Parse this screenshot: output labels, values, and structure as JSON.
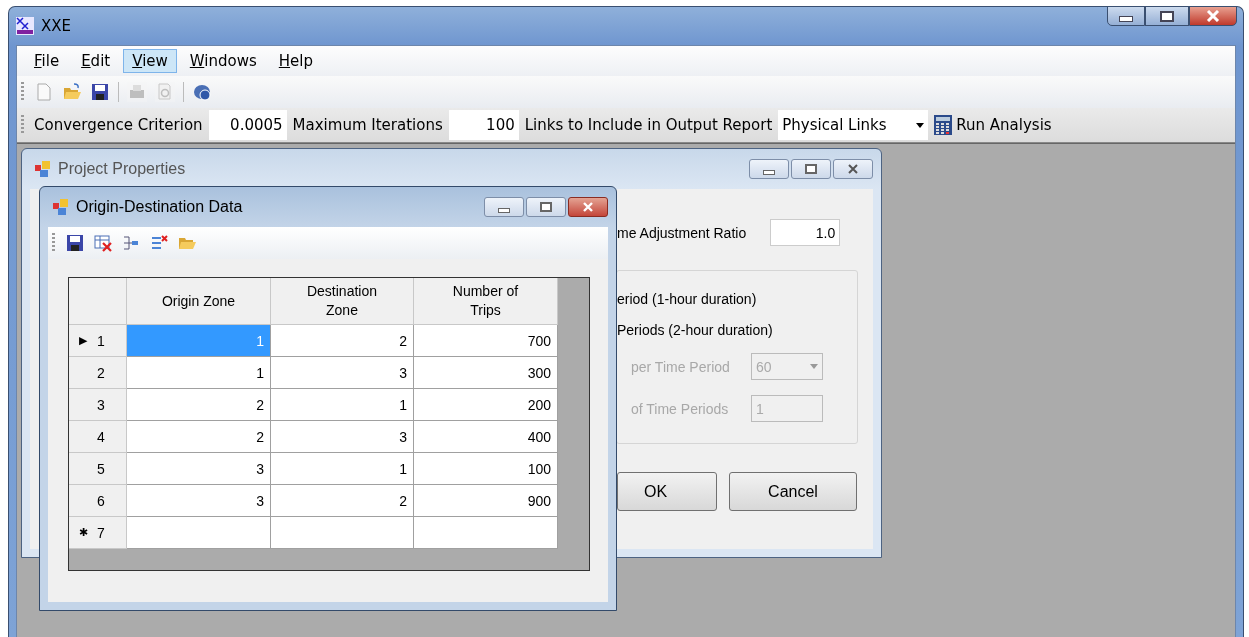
{
  "window": {
    "title": "XXE"
  },
  "menu": [
    {
      "label": "File",
      "selected": false
    },
    {
      "label": "Edit",
      "selected": false
    },
    {
      "label": "View",
      "selected": true
    },
    {
      "label": "Windows",
      "selected": false
    },
    {
      "label": "Help",
      "selected": false
    }
  ],
  "toolbar": [
    {
      "kind": "new",
      "disabled": false
    },
    {
      "kind": "open",
      "disabled": false
    },
    {
      "kind": "save",
      "disabled": false
    },
    {
      "kind": "separator"
    },
    {
      "kind": "print",
      "disabled": true
    },
    {
      "kind": "preview",
      "disabled": true
    },
    {
      "kind": "separator"
    },
    {
      "kind": "help",
      "disabled": false
    }
  ],
  "params": {
    "convergence_label": "Convergence Criterion",
    "convergence_value": "0.0005",
    "iterations_label": "Maximum Iterations",
    "iterations_value": "100",
    "links_label": "Links to Include in Output Report",
    "links_value": "Physical Links",
    "run_label": "Run Analysis"
  },
  "project_properties": {
    "title": "Project Properties",
    "ratio_label": "me Adjustment Ratio",
    "ratio_value": "1.0",
    "options": [
      "eriod (1-hour duration)",
      "Periods (2-hour duration)"
    ],
    "per_period_label": "per Time Period",
    "per_period_value": "60",
    "periods_label": "of Time Periods",
    "periods_value": "1",
    "disabled": true,
    "ok": "OK",
    "cancel": "Cancel"
  },
  "od_data": {
    "title": "Origin-Destination Data",
    "toolbar": [
      {
        "kind": "save"
      },
      {
        "kind": "delete"
      },
      {
        "kind": "insert"
      },
      {
        "kind": "remove"
      },
      {
        "kind": "open"
      }
    ],
    "columns": [
      {
        "label": "Origin Zone"
      },
      {
        "label": "Destination\nZone"
      },
      {
        "label": "Number of\nTrips"
      }
    ],
    "rows": [
      {
        "indicator": "▶",
        "number": "1",
        "cells": [
          {
            "text": "1",
            "selected": true
          },
          {
            "text": "2",
            "selected": false
          },
          {
            "text": "700",
            "selected": false
          }
        ]
      },
      {
        "number": "2",
        "cells": [
          {
            "text": "1",
            "selected": false
          },
          {
            "text": "3",
            "selected": false
          },
          {
            "text": "300",
            "selected": false
          }
        ]
      },
      {
        "number": "3",
        "cells": [
          {
            "text": "2",
            "selected": false
          },
          {
            "text": "1",
            "selected": false
          },
          {
            "text": "200",
            "selected": false
          }
        ]
      },
      {
        "number": "4",
        "cells": [
          {
            "text": "2",
            "selected": false
          },
          {
            "text": "3",
            "selected": false
          },
          {
            "text": "400",
            "selected": false
          }
        ]
      },
      {
        "number": "5",
        "cells": [
          {
            "text": "3",
            "selected": false
          },
          {
            "text": "1",
            "selected": false
          },
          {
            "text": "100",
            "selected": false
          }
        ]
      },
      {
        "number": "6",
        "cells": [
          {
            "text": "3",
            "selected": false
          },
          {
            "text": "2",
            "selected": false
          },
          {
            "text": "900",
            "selected": false
          }
        ]
      },
      {
        "indicator": "✱",
        "number": "7",
        "cells": []
      }
    ]
  }
}
